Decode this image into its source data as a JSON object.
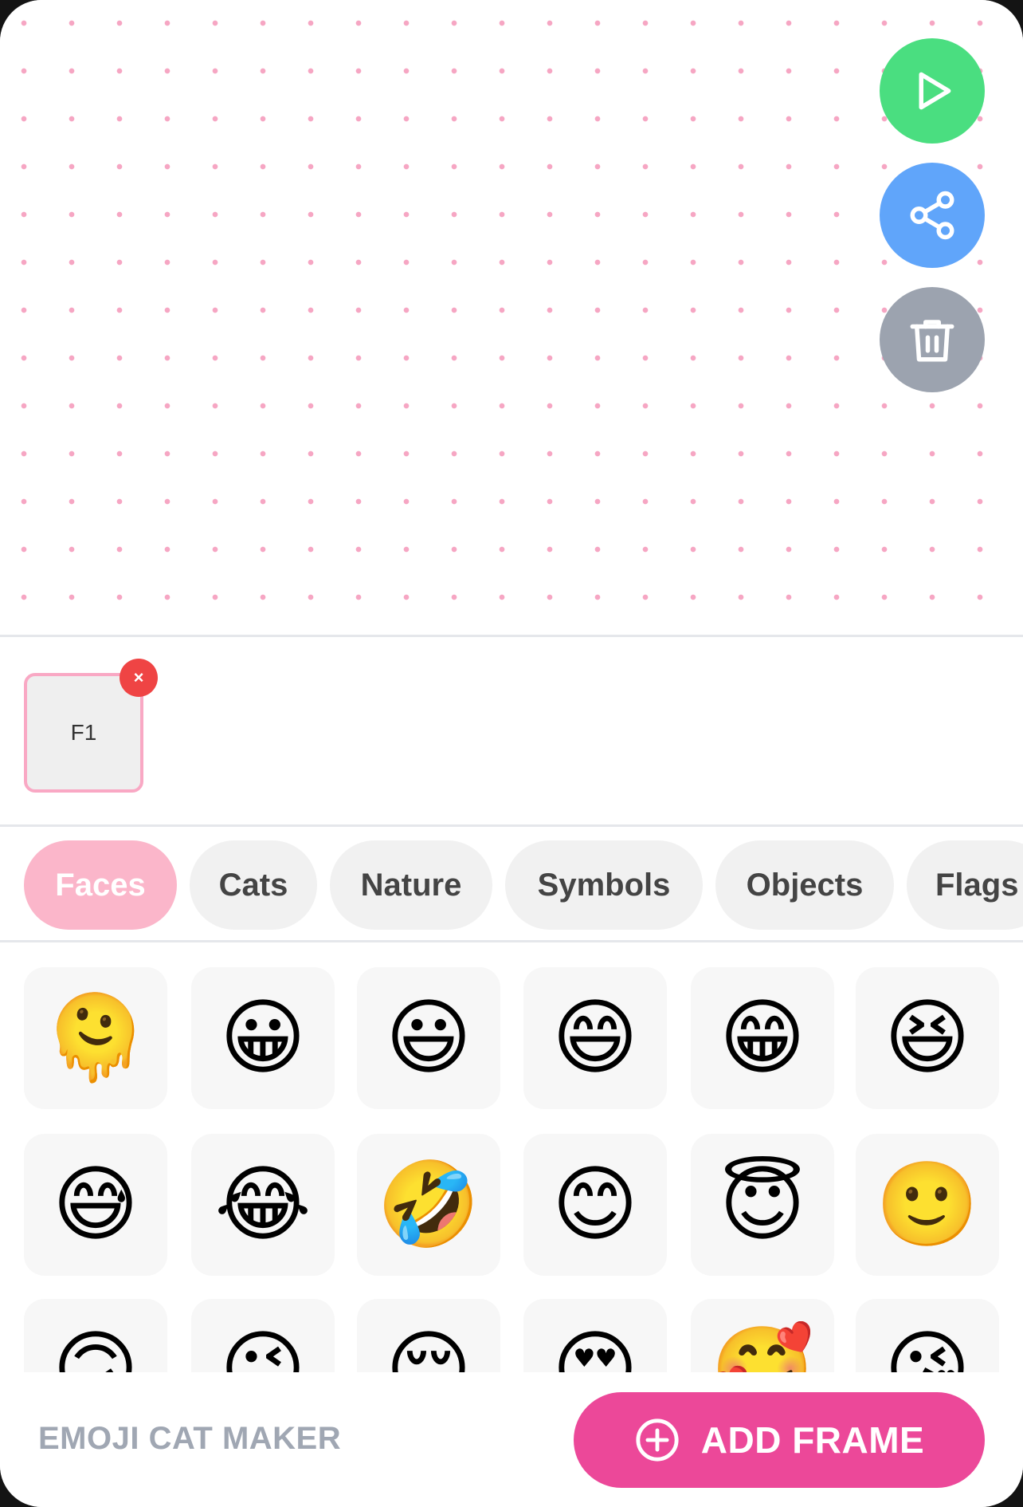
{
  "canvas": {
    "dot_color": "#f6a6c3"
  },
  "actions": {
    "play_color": "#4ade80",
    "share_color": "#60a5fa",
    "delete_color": "#9ca3af"
  },
  "frames": [
    {
      "label": "F1",
      "remove_glyph": "×"
    }
  ],
  "categories": {
    "active": "Faces",
    "tabs": [
      "Faces",
      "Cats",
      "Nature",
      "Symbols",
      "Objects",
      "Flags"
    ]
  },
  "emoji_grid": [
    "🫠",
    "😀",
    "😃",
    "😄",
    "😁",
    "😆",
    "😅",
    "😂",
    "🤣",
    "😊",
    "😇",
    "🙂",
    "🙃",
    "😉",
    "😌",
    "😍",
    "🥰",
    "😘"
  ],
  "footer": {
    "app_title": "EMOJI CAT MAKER",
    "add_frame_label": "ADD FRAME",
    "add_frame_color": "#ec4899"
  }
}
